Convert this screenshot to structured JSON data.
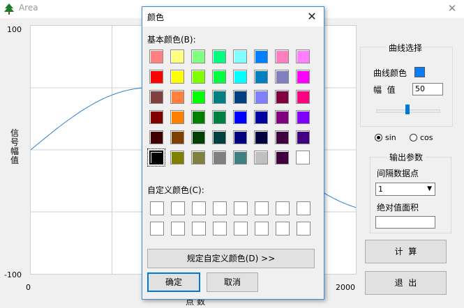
{
  "window": {
    "title": "Area",
    "close_glyph": "✕"
  },
  "plot": {
    "y_max": "100",
    "y_min": "-100",
    "x_min": "0",
    "x_max": "2000",
    "ylabel": "信号幅值",
    "xlabel": "点数",
    "curve": "sin",
    "amplitude": 50
  },
  "curve_group": {
    "title": "曲线选择",
    "color_label": "曲线颜色",
    "color_value": "#0a7cf5",
    "amp_label": "幅  值",
    "amp_value": "50",
    "slider_fraction": 0.5
  },
  "radio": {
    "sin": "sin",
    "cos": "cos",
    "selected": "sin"
  },
  "output_group": {
    "title": "输出参数",
    "interval_label": "间隔数据点",
    "interval_value": "1",
    "area_label": "绝对值面积",
    "area_value": ""
  },
  "buttons": {
    "calc": "计  算",
    "exit": "退  出"
  },
  "dialog": {
    "title": "颜色",
    "basic_label": "基本颜色(B):",
    "custom_label": "自定义颜色(C):",
    "define_button": "规定自定义颜色(D) >>",
    "ok": "确定",
    "cancel": "取消",
    "close_glyph": "✕",
    "basic_colors": [
      [
        "#ff8080",
        "#ffff80",
        "#80ff80",
        "#00ff80",
        "#80ffff",
        "#0080ff",
        "#ff80c0",
        "#ff80ff"
      ],
      [
        "#ff0000",
        "#ffff00",
        "#80ff00",
        "#00ff40",
        "#00ffff",
        "#0080c0",
        "#8080c0",
        "#ff00ff"
      ],
      [
        "#804040",
        "#ff8040",
        "#00ff00",
        "#008080",
        "#004080",
        "#8080ff",
        "#800040",
        "#ff0080"
      ],
      [
        "#800000",
        "#ff8000",
        "#008000",
        "#008040",
        "#0000ff",
        "#0000a0",
        "#800080",
        "#8000ff"
      ],
      [
        "#400000",
        "#804000",
        "#004000",
        "#004040",
        "#000080",
        "#000040",
        "#400040",
        "#400080"
      ],
      [
        "#000000",
        "#808000",
        "#808040",
        "#808080",
        "#408080",
        "#c0c0c0",
        "#400040",
        "#ffffff"
      ]
    ],
    "selected_swatch": "#000000"
  }
}
